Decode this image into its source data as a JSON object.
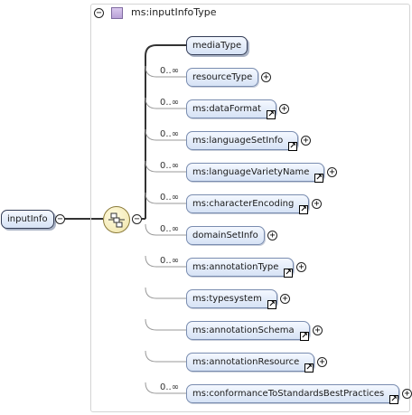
{
  "root": {
    "label": "inputInfo",
    "toggle": "−"
  },
  "type": {
    "label": "ms:inputInfoType",
    "toggle": "−"
  },
  "compositor": {
    "kind": "sequence",
    "toggle": "−"
  },
  "elements": [
    {
      "label": "mediaType",
      "cardinality": "",
      "strong": true,
      "ref": false,
      "expand": false
    },
    {
      "label": "resourceType",
      "cardinality": "0..∞",
      "strong": false,
      "ref": false,
      "expand": true
    },
    {
      "label": "ms:dataFormat",
      "cardinality": "0..∞",
      "strong": false,
      "ref": true,
      "expand": true
    },
    {
      "label": "ms:languageSetInfo",
      "cardinality": "0..∞",
      "strong": false,
      "ref": true,
      "expand": true
    },
    {
      "label": "ms:languageVarietyName",
      "cardinality": "0..∞",
      "strong": false,
      "ref": true,
      "expand": true
    },
    {
      "label": "ms:characterEncoding",
      "cardinality": "0..∞",
      "strong": false,
      "ref": true,
      "expand": true
    },
    {
      "label": "domainSetInfo",
      "cardinality": "0..∞",
      "strong": false,
      "ref": false,
      "expand": true
    },
    {
      "label": "ms:annotationType",
      "cardinality": "0..∞",
      "strong": false,
      "ref": true,
      "expand": true
    },
    {
      "label": "ms:typesystem",
      "cardinality": "",
      "strong": false,
      "ref": true,
      "expand": true
    },
    {
      "label": "ms:annotationSchema",
      "cardinality": "",
      "strong": false,
      "ref": true,
      "expand": true
    },
    {
      "label": "ms:annotationResource",
      "cardinality": "",
      "strong": false,
      "ref": true,
      "expand": true
    },
    {
      "label": "ms:conformanceToStandardsBestPractices",
      "cardinality": "0..∞",
      "strong": false,
      "ref": true,
      "expand": true
    }
  ],
  "glyphs": {
    "expand": "+",
    "ref": "↗"
  }
}
